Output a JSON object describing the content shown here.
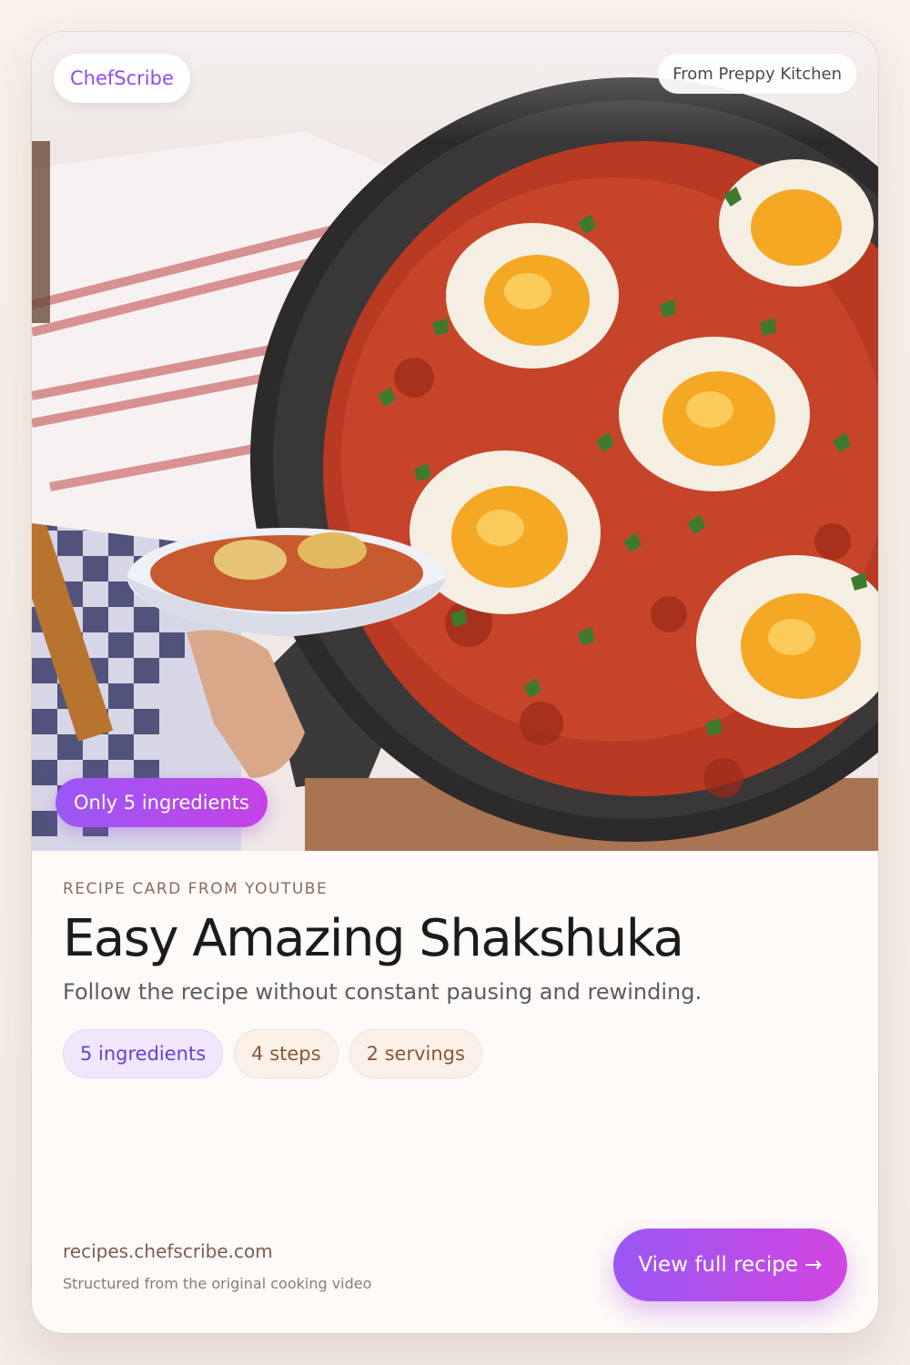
{
  "brand": {
    "name": "ChefScribe"
  },
  "hero": {
    "source_label": "From Preppy Kitchen",
    "ingredient_badge": "Only 5 ingredients",
    "image_subject": "shakshuka-in-cast-iron-skillet"
  },
  "recipe": {
    "eyebrow": "RECIPE CARD FROM YOUTUBE",
    "title": "Easy Amazing Shakshuka",
    "subtitle": "Follow the recipe without constant pausing and rewinding.",
    "chips": [
      "5 ingredients",
      "4 steps",
      "2 servings"
    ]
  },
  "footer": {
    "domain": "recipes.chefscribe.com",
    "tagline": "Structured from the original cooking video",
    "cta_label": "View full recipe →"
  },
  "colors": {
    "accent_start": "#9a57f5",
    "accent_end": "#d146e0",
    "brand_text": "#8b4ef0",
    "page_bg": "#f8f1ec"
  }
}
